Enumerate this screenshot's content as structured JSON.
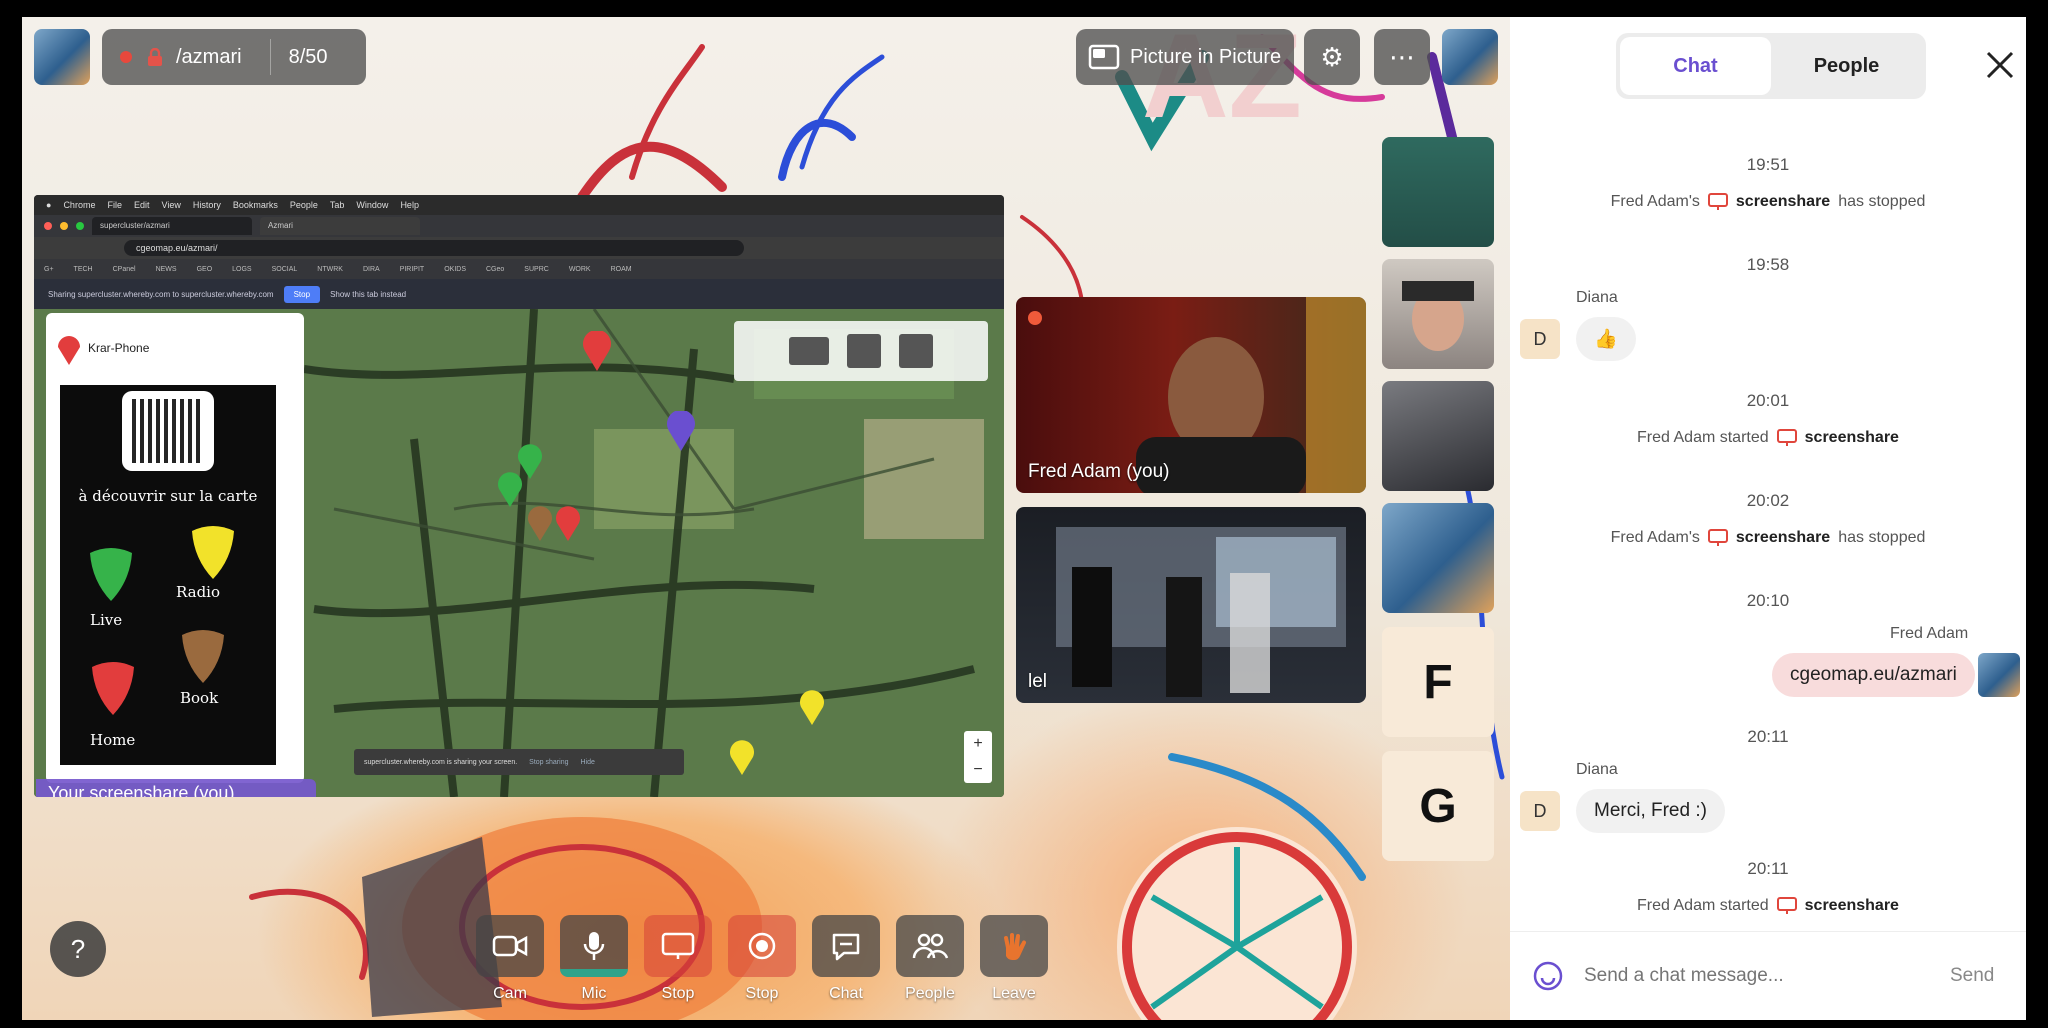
{
  "room": {
    "name": "/azmari",
    "count": "8/50"
  },
  "top": {
    "pip_label": "Picture in Picture"
  },
  "screenshare": {
    "url": "cgeomap.eu/azmari/",
    "tab_title": "Azmari",
    "banner_text": "Sharing supercluster.whereby.com to supercluster.whereby.com",
    "banner_stop": "Stop",
    "banner_switch": "Show this tab instead",
    "panel_title": "Krar-Phone",
    "poster_title": "à découvrir sur la carte",
    "poster_items": [
      "Live",
      "Radio",
      "Home",
      "Book"
    ],
    "notice": "supercluster.whereby.com is sharing your screen.",
    "notice_stop": "Stop sharing",
    "notice_hide": "Hide",
    "label": "Your screenshare (you)"
  },
  "videos": {
    "fred": "Fred Adam (you)",
    "lel": "lel",
    "letters": [
      "F",
      "G"
    ]
  },
  "toolbar": {
    "items": [
      {
        "label": "Cam"
      },
      {
        "label": "Mic"
      },
      {
        "label": "Stop"
      },
      {
        "label": "Stop"
      },
      {
        "label": "Chat"
      },
      {
        "label": "People"
      },
      {
        "label": "Leave"
      }
    ]
  },
  "help": "?",
  "panel": {
    "tabs": [
      "Chat",
      "People"
    ],
    "messages": {
      "t1": "19:51",
      "s1_pre": "Fred Adam's",
      "s1_mid": "screenshare",
      "s1_post": "has stopped",
      "t2": "19:58",
      "m2_sender": "Diana",
      "m2_avatar": "D",
      "m2_text": "👍",
      "t3": "20:01",
      "s3_pre": "Fred Adam started",
      "s3_mid": "screenshare",
      "t4": "20:02",
      "s4_pre": "Fred Adam's",
      "s4_mid": "screenshare",
      "s4_post": "has stopped",
      "t5": "20:10",
      "m5_sender": "Fred Adam",
      "m5_text": "cgeomap.eu/azmari",
      "t6": "20:11",
      "m6_sender": "Diana",
      "m6_avatar": "D",
      "m6_text": "Merci, Fred :)",
      "t7": "20:11",
      "s7_pre": "Fred Adam started",
      "s7_mid": "screenshare"
    },
    "composer_placeholder": "Send a chat message...",
    "send": "Send"
  },
  "colors": {
    "accent": "#6a4fd0",
    "record": "#e8483c",
    "mine_bubble": "#f8dcdc",
    "screen_icon": "#e0463c"
  }
}
